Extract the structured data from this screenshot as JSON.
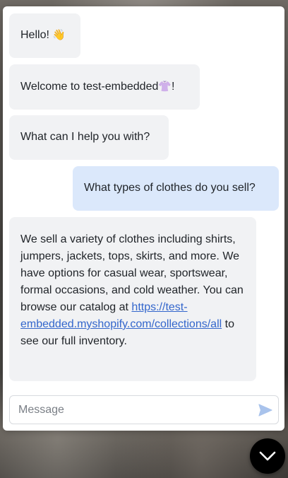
{
  "chat": {
    "messages": [
      {
        "role": "bot",
        "text": "Hello! ",
        "emoji": "👋"
      },
      {
        "role": "bot",
        "text_before": "Welcome to test-embedded",
        "emoji": "👚",
        "text_after": "!"
      },
      {
        "role": "bot",
        "text": "What can I help you with?"
      },
      {
        "role": "user",
        "text": "What types of clothes do you sell?"
      },
      {
        "role": "bot",
        "text": "We sell a variety of clothes including shirts, jumpers, jackets, tops, skirts, and more. We have options for casual wear, sportswear, formal occasions, and cold weather. You can browse our catalog at ",
        "link": "https://test-embedded.myshopify.com/collections/all",
        "text_after": " to see our full inventory."
      }
    ]
  },
  "composer": {
    "placeholder": "Message",
    "value": "",
    "send_icon": "send-icon"
  },
  "launcher": {
    "icon": "chevron-down-icon"
  },
  "colors": {
    "bot_bubble": "#f1f2f4",
    "user_bubble": "#dbe8fb",
    "link": "#3366cc",
    "send_icon": "#a9c3ec",
    "launcher_bg": "#000000"
  }
}
